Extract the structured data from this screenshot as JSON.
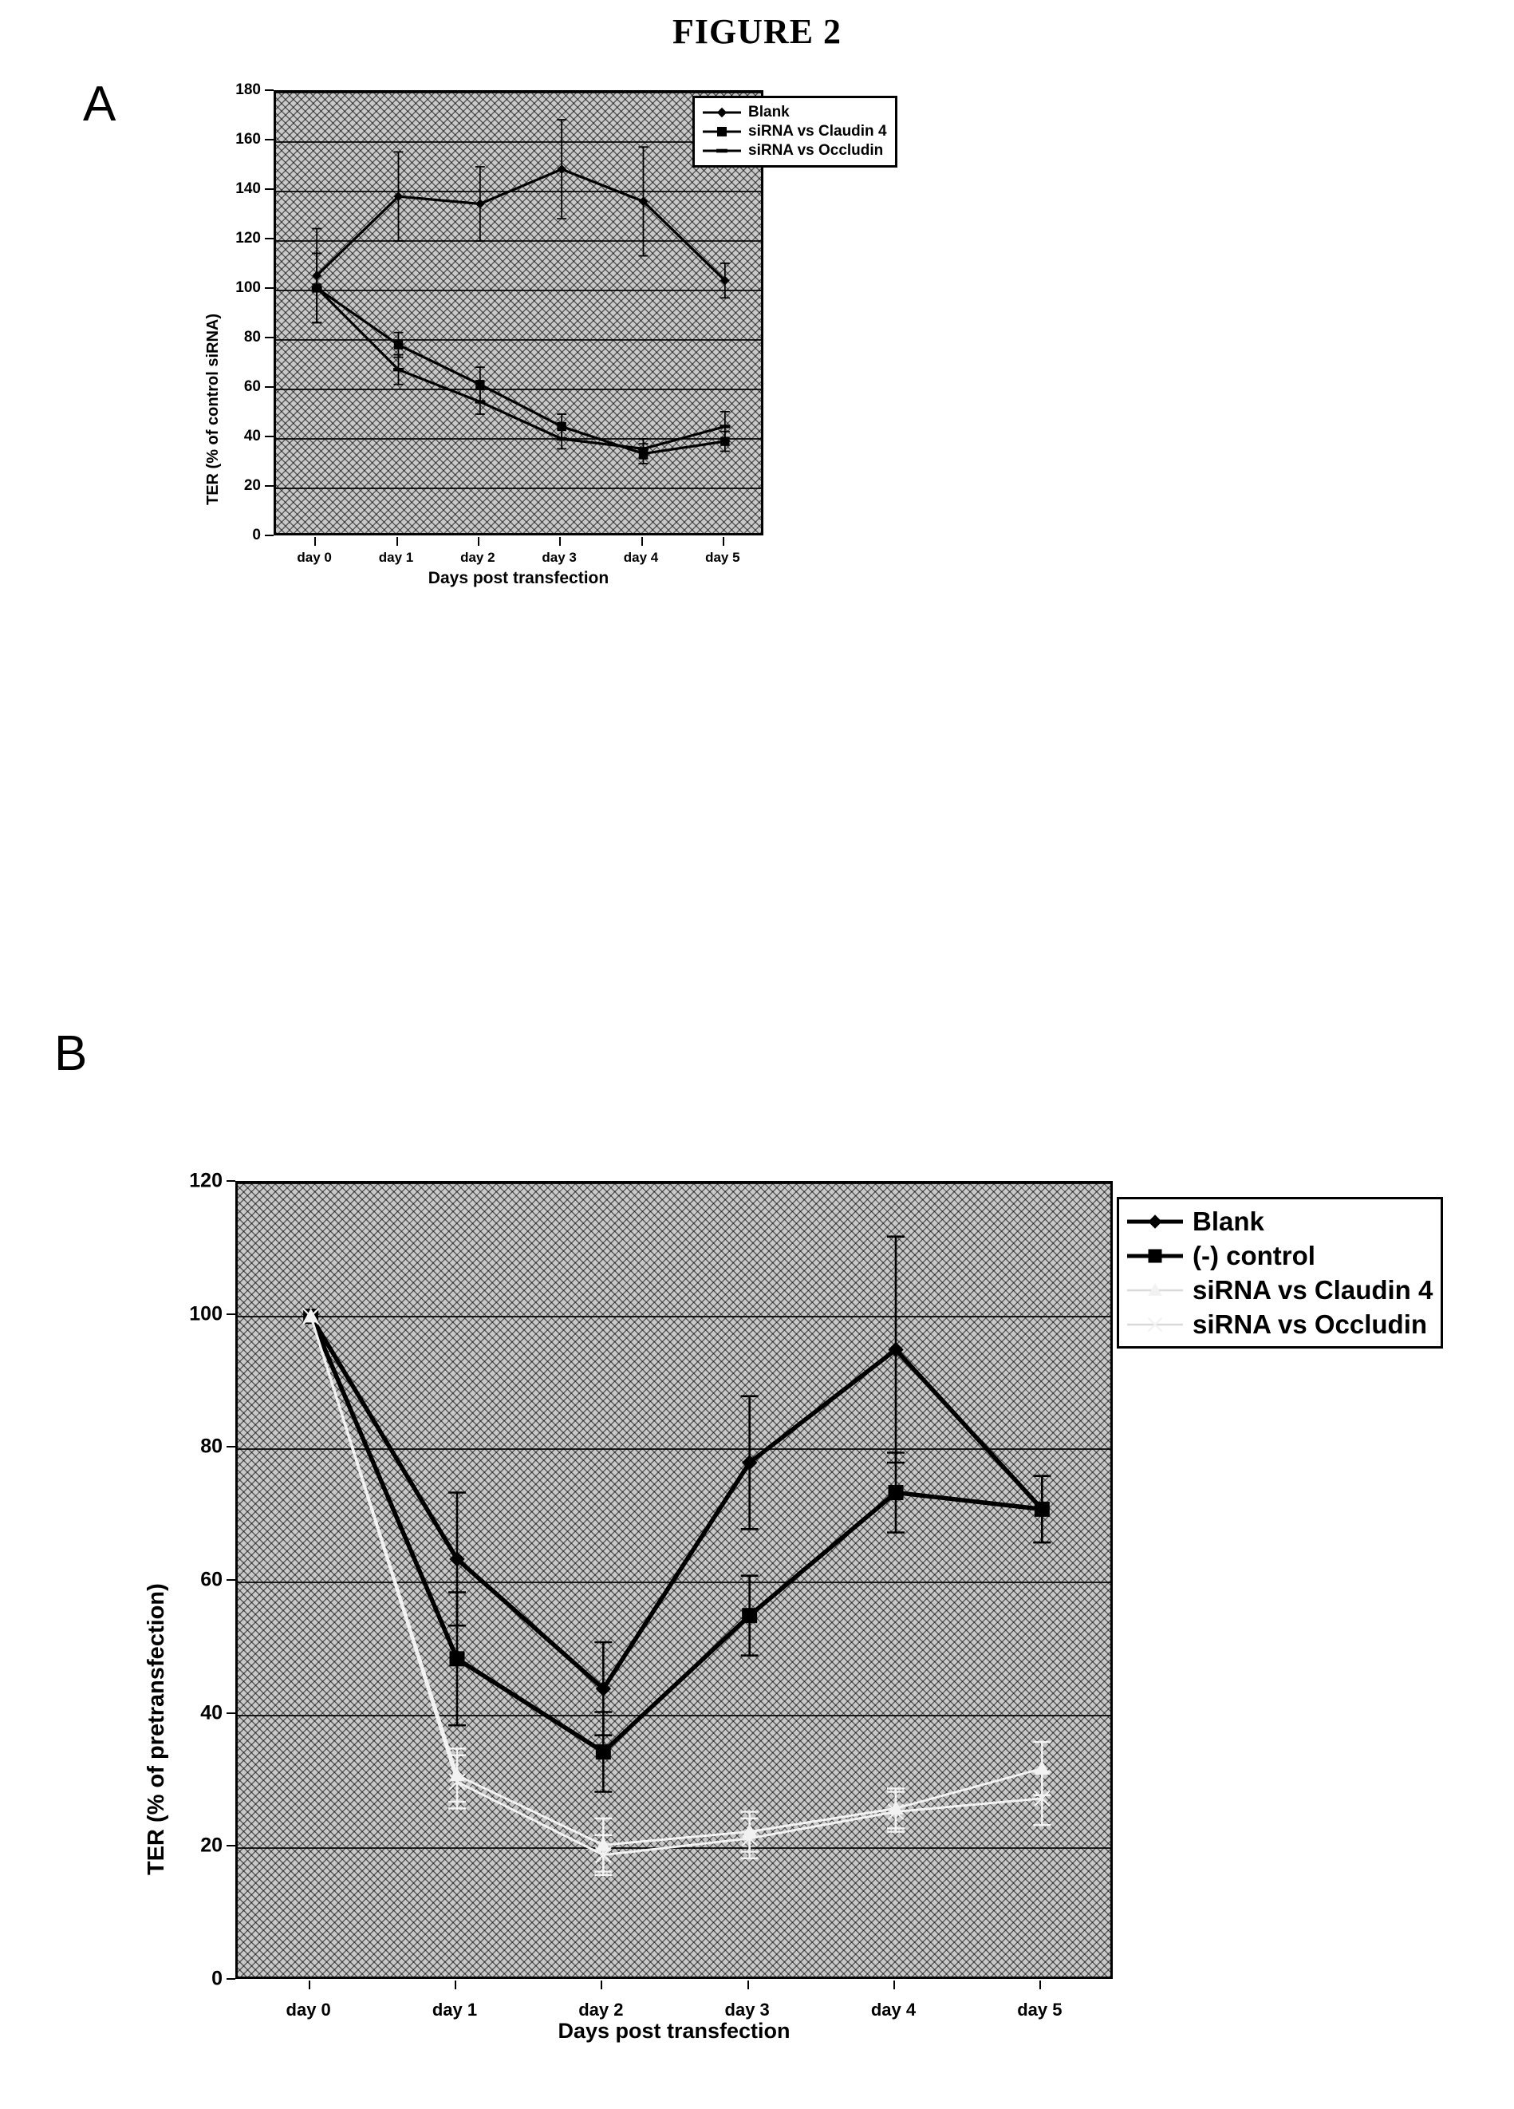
{
  "figure": {
    "title": "FIGURE 2",
    "panels": [
      {
        "letter": "A"
      },
      {
        "letter": "B"
      }
    ]
  },
  "panel_a": {
    "letter": "A",
    "legend": [
      {
        "label": "Blank",
        "marker": "diamond"
      },
      {
        "label": "siRNA vs Claudin 4",
        "marker": "square"
      },
      {
        "label": "siRNA vs Occludin",
        "marker": "dash"
      }
    ]
  },
  "panel_b": {
    "letter": "B",
    "legend": [
      {
        "label": "Blank",
        "marker": "diamond"
      },
      {
        "label": "(-) control",
        "marker": "square"
      },
      {
        "label": "siRNA vs Claudin 4",
        "marker": "triangle-light"
      },
      {
        "label": "siRNA vs Occludin",
        "marker": "cross-light"
      }
    ]
  },
  "chart_data": [
    {
      "type": "line",
      "panel": "A",
      "title": "",
      "xlabel": "Days post transfection",
      "ylabel": "TER (% of control siRNA)",
      "categories": [
        "day 0",
        "day 1",
        "day 2",
        "day 3",
        "day 4",
        "day 5"
      ],
      "ylim": [
        0,
        180
      ],
      "yticks": [
        0,
        20,
        40,
        60,
        80,
        100,
        120,
        140,
        160,
        180
      ],
      "grid": true,
      "legend_position": "top-right",
      "series": [
        {
          "name": "Blank",
          "marker": "diamond",
          "values": [
            106,
            138,
            135,
            149,
            136,
            104
          ],
          "errors": [
            19,
            18,
            15,
            20,
            22,
            7
          ]
        },
        {
          "name": "siRNA vs Claudin 4",
          "marker": "square",
          "values": [
            101,
            78,
            62,
            45,
            34,
            39
          ],
          "errors": [
            14,
            5,
            7,
            5,
            4,
            4
          ]
        },
        {
          "name": "siRNA vs Occludin",
          "marker": "dash",
          "values": [
            101,
            68,
            55,
            40,
            36,
            45
          ],
          "errors": [
            14,
            6,
            5,
            4,
            4,
            6
          ]
        }
      ]
    },
    {
      "type": "line",
      "panel": "B",
      "title": "",
      "xlabel": "Days post transfection",
      "ylabel": "TER (% of pretransfection)",
      "categories": [
        "day 0",
        "day 1",
        "day 2",
        "day 3",
        "day 4",
        "day 5"
      ],
      "ylim": [
        0,
        120
      ],
      "yticks": [
        0,
        20,
        40,
        60,
        80,
        100,
        120
      ],
      "grid": true,
      "legend_position": "top-right",
      "series": [
        {
          "name": "Blank",
          "marker": "diamond",
          "values": [
            100,
            63.5,
            44,
            78,
            95,
            71
          ],
          "errors": [
            0,
            10,
            7,
            10,
            17,
            5
          ]
        },
        {
          "name": "(-) control",
          "marker": "square",
          "values": [
            100,
            48.5,
            34.5,
            55,
            73.5,
            71
          ],
          "errors": [
            0,
            10,
            6,
            6,
            6,
            5
          ]
        },
        {
          "name": "siRNA vs Claudin 4",
          "marker": "triangle-light",
          "values": [
            100,
            31,
            20.5,
            22.5,
            26,
            32
          ],
          "errors": [
            0,
            4,
            4,
            3,
            3,
            4
          ]
        },
        {
          "name": "siRNA vs Occludin",
          "marker": "cross-light",
          "values": [
            100,
            30,
            19,
            21.5,
            25.5,
            27.5
          ],
          "errors": [
            0,
            4,
            3,
            3,
            3,
            4
          ]
        }
      ]
    }
  ]
}
